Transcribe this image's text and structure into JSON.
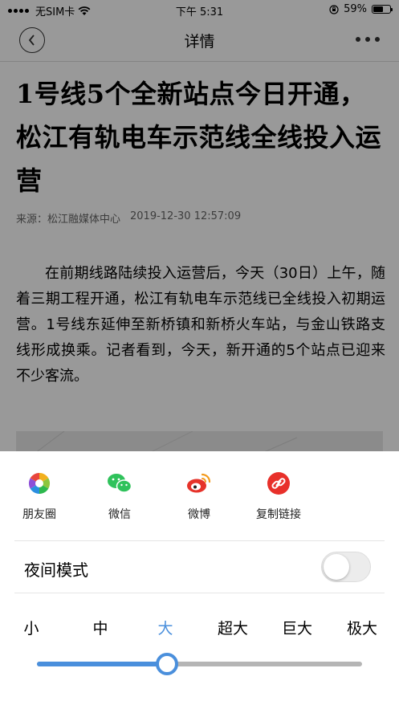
{
  "status_bar": {
    "carrier": "无SIM卡",
    "time": "下午 5:31",
    "battery": "59%",
    "battery_level": 0.59
  },
  "nav": {
    "title": "详情"
  },
  "article": {
    "title": "1号线5个全新站点今日开通，松江有轨电车示范线全线投入运营",
    "source": "来源：松江融媒体中心",
    "datetime": "2019-12-30 12:57:09",
    "body": "在前期线路陆续投入运营后，今天（30日）上午，随着三期工程开通，松江有轨电车示范线已全线投入初期运营。1号线东延伸至新桥镇和新桥火车站，与金山铁路支线形成换乘。记者看到，今天，新开通的5个站点已迎来不少客流。"
  },
  "share": {
    "items": [
      {
        "label": "朋友圈",
        "icon": "moments-icon"
      },
      {
        "label": "微信",
        "icon": "wechat-icon"
      },
      {
        "label": "微博",
        "icon": "weibo-icon"
      },
      {
        "label": "复制链接",
        "icon": "link-icon"
      }
    ]
  },
  "night_mode": {
    "label": "夜间模式",
    "enabled": false
  },
  "font_size": {
    "options": [
      "小",
      "中",
      "大",
      "超大",
      "巨大",
      "极大"
    ],
    "selected_index": 2,
    "accent_color": "#4a8fdc"
  }
}
